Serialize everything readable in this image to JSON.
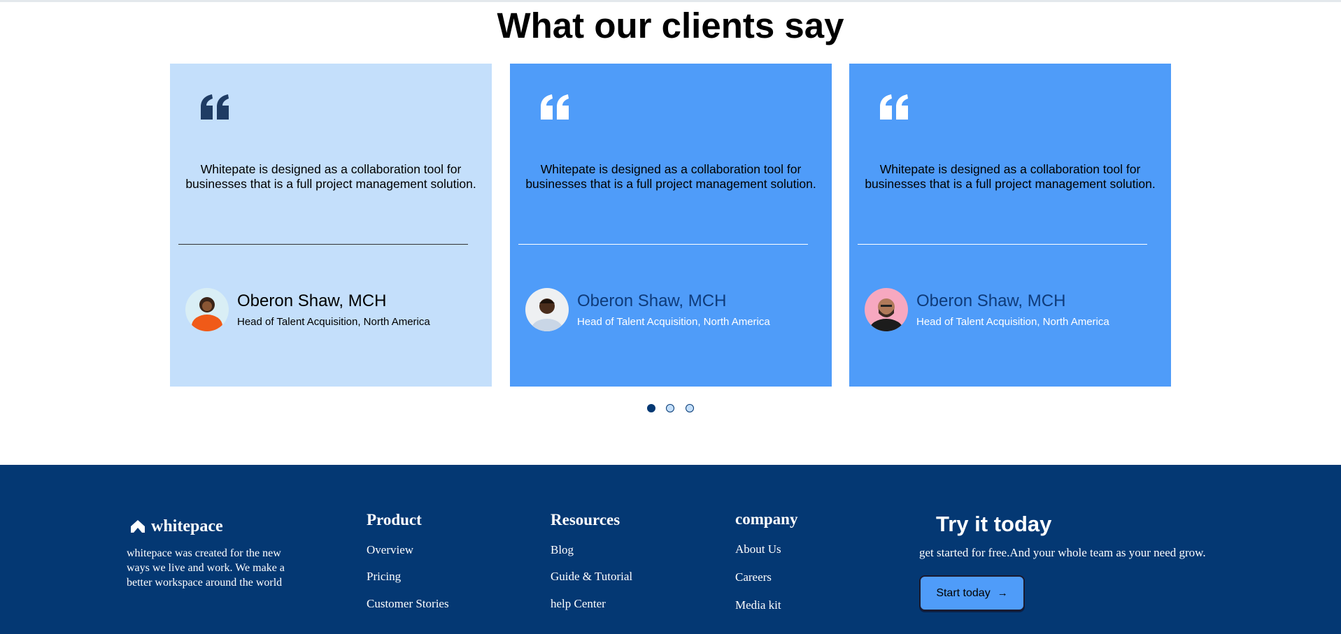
{
  "section": {
    "title": "What our clients say"
  },
  "testimonials": [
    {
      "quote": "Whitepate is designed as a collaboration tool for businesses that is a full project management solution.",
      "name": "Oberon Shaw, MCH",
      "role": "Head of Talent Acquisition, North America",
      "background": "#c4dffb"
    },
    {
      "quote": "Whitepate is designed as a collaboration tool for businesses that is a full project management solution.",
      "name": "Oberon Shaw, MCH",
      "role": "Head of Talent Acquisition, North America",
      "background": "#4f9cf9"
    },
    {
      "quote": "Whitepate is designed as a collaboration tool for businesses that is a full project management solution.",
      "name": "Oberon Shaw, MCH",
      "role": "Head of Talent Acquisition, North America",
      "background": "#4f9cf9"
    }
  ],
  "carousel": {
    "page_count": 3,
    "active_index": 0
  },
  "footer": {
    "brand": "whitepace",
    "description": "whitepace was created for the new ways we live and work. We make a better workspace around the world",
    "columns": [
      {
        "title": "Product",
        "links": [
          "Overview",
          "Pricing",
          "Customer Stories"
        ]
      },
      {
        "title": "Resources",
        "links": [
          "Blog",
          "Guide & Tutorial",
          "help Center"
        ]
      },
      {
        "title": "company",
        "links": [
          "About Us",
          "Careers",
          "Media kit"
        ]
      }
    ],
    "cta": {
      "title": "Try it today",
      "subtitle": "get started for free.And your whole team as your need grow.",
      "button_label": "Start today",
      "button_icon": "arrow-right-icon"
    }
  },
  "colors": {
    "footer_bg": "#043873",
    "card_light": "#c4dffb",
    "card_blue": "#4f9cf9",
    "accent_dark": "#043873"
  }
}
